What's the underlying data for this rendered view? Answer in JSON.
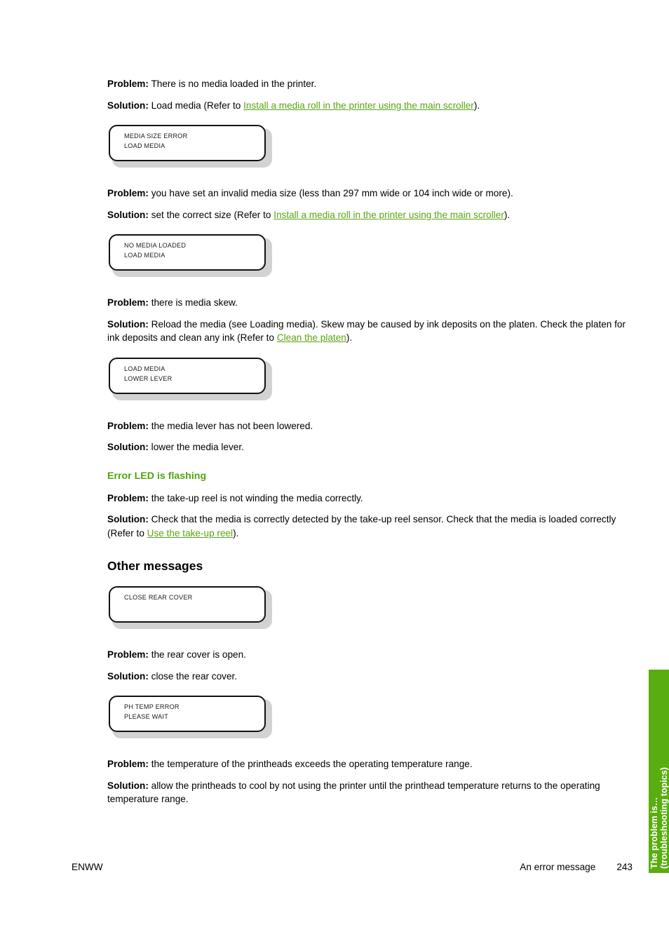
{
  "page": {
    "number": "243",
    "footer_left": "ENWW",
    "footer_section": "An error message",
    "side_tab_line1": "The problem is…",
    "side_tab_line2": "(troubleshooting topics)",
    "accent_green": "#5aad11",
    "link_green": "#59a412",
    "heading_green": "#52a311"
  },
  "blocks": {
    "b1": {
      "problem_label": "Problem:",
      "problem_text": " There is no media loaded in the printer.",
      "solution_label": "Solution:",
      "solution_pre": " Load media (Refer to ",
      "solution_link": "Install a media roll in the printer using the main scroller",
      "solution_post": ")."
    },
    "b2": {
      "problem_label": "Problem:",
      "problem_text": " you have set an invalid media size (less than 297 mm wide or 104 inch wide or more).",
      "solution_label": "Solution:",
      "solution_pre": " set the correct size (Refer to ",
      "solution_link": "Install a media roll in the printer using the main scroller",
      "solution_post": ")."
    },
    "b3": {
      "problem_label": "Problem:",
      "problem_text": " there is media skew.",
      "solution_label": "Solution:",
      "solution_pre": " Reload the media (see Loading media). Skew may be caused by ink deposits on the platen. Check the platen for ink deposits and clean any ink (Refer to ",
      "solution_link": "Clean the platen",
      "solution_post": ")."
    },
    "b4": {
      "problem_label": "Problem:",
      "problem_text": " the media lever has not been lowered.",
      "solution_label": "Solution:",
      "solution_text": " lower the media lever."
    },
    "b5": {
      "heading": "Error LED is flashing",
      "problem_label": "Problem:",
      "problem_text": " the take-up reel is not winding the media correctly.",
      "solution_label": "Solution:",
      "solution_pre": " Check that the media is correctly detected by the take-up reel sensor. Check that the media is loaded correctly (Refer to ",
      "solution_link": "Use the take-up reel",
      "solution_post": ")."
    },
    "b6": {
      "heading": "Other messages",
      "problem_label": "Problem:",
      "problem_text": " the rear cover is open.",
      "solution_label": "Solution:",
      "solution_text": " close the rear cover."
    },
    "b7": {
      "problem_label": "Problem:",
      "problem_text": " the temperature of the printheads exceeds the operating temperature range.",
      "solution_label": "Solution:",
      "solution_text": " allow the printheads to cool by not using the printer until the printhead temperature returns to the operating temperature range."
    }
  },
  "lcd_panels": {
    "p1": {
      "line1": "MEDIA SIZE ERROR",
      "line2": "LOAD MEDIA"
    },
    "p2": {
      "line1": "NO MEDIA LOADED",
      "line2": "LOAD MEDIA"
    },
    "p3": {
      "line1": "LOAD MEDIA",
      "line2": "LOWER LEVER"
    },
    "p4": {
      "line1": "CLOSE REAR COVER",
      "line2": ""
    },
    "p5": {
      "line1": "PH TEMP ERROR",
      "line2": "PLEASE WAIT"
    }
  }
}
